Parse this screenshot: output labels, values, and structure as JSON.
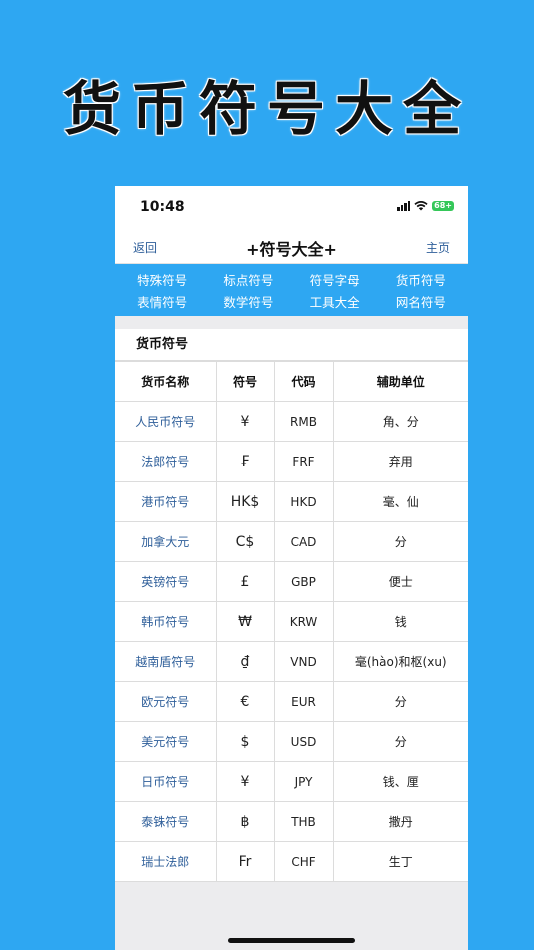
{
  "banner_title": "货币符号大全",
  "status": {
    "time": "10:48",
    "battery": "68+"
  },
  "nav": {
    "back": "返回",
    "title": "+符号大全+",
    "home": "主页"
  },
  "categories": [
    "特殊符号",
    "标点符号",
    "符号字母",
    "货币符号",
    "表情符号",
    "数学符号",
    "工具大全",
    "网名符号"
  ],
  "section_title": "货币符号",
  "table": {
    "headers": [
      "货币名称",
      "符号",
      "代码",
      "辅助单位"
    ],
    "rows": [
      [
        "人民币符号",
        "¥",
        "RMB",
        "角、分"
      ],
      [
        "法郎符号",
        "₣",
        "FRF",
        "弃用"
      ],
      [
        "港币符号",
        "HK$",
        "HKD",
        "毫、仙"
      ],
      [
        "加拿大元",
        "C$",
        "CAD",
        "分"
      ],
      [
        "英镑符号",
        "£",
        "GBP",
        "便士"
      ],
      [
        "韩币符号",
        "₩",
        "KRW",
        "钱"
      ],
      [
        "越南盾符号",
        "₫",
        "VND",
        "毫(hào)和枢(xu)"
      ],
      [
        "欧元符号",
        "€",
        "EUR",
        "分"
      ],
      [
        "美元符号",
        "$",
        "USD",
        "分"
      ],
      [
        "日币符号",
        "¥",
        "JPY",
        "钱、厘"
      ],
      [
        "泰铢符号",
        "฿",
        "THB",
        "撒丹"
      ],
      [
        "瑞士法郎",
        "Fr",
        "CHF",
        "生丁"
      ]
    ]
  }
}
